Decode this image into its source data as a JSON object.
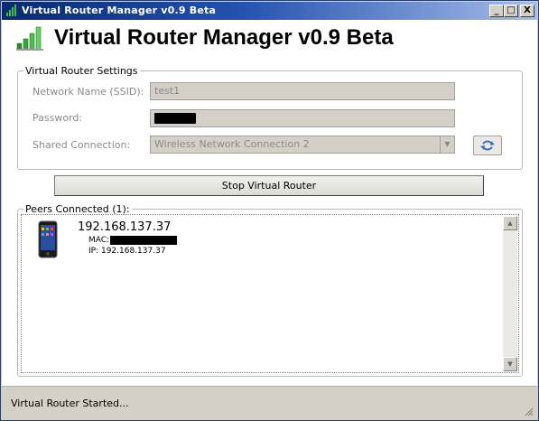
{
  "window": {
    "title": "Virtual Router Manager v0.9 Beta",
    "controls": {
      "minimize": "_",
      "maximize": "□",
      "close": "X"
    }
  },
  "header": {
    "app_title": "Virtual Router Manager v0.9 Beta",
    "logo_icon": "signal-bars-icon"
  },
  "settings": {
    "group_label": "Virtual Router Settings",
    "ssid_label": "Network Name (SSID):",
    "ssid_value": "test1",
    "password_label": "Password:",
    "password_value": "",
    "shared_label": "Shared Connection:",
    "shared_value": "Wireless Network Connection 2",
    "refresh_icon": "refresh-arrows-icon"
  },
  "actions": {
    "stop_label": "Stop Virtual Router"
  },
  "peers": {
    "group_label": "Peers Connected (1):",
    "items": [
      {
        "icon": "phone-icon",
        "title": "192.168.137.37",
        "mac_label": "MAC:",
        "ip_line": "IP: 192.168.137.37"
      }
    ]
  },
  "status": {
    "text": "Virtual Router Started..."
  },
  "colors": {
    "titlebar_start": "#0a2a6e",
    "titlebar_end": "#a7bde8",
    "chrome": "#d4d0c8",
    "accent_green": "#3a9a3a"
  }
}
